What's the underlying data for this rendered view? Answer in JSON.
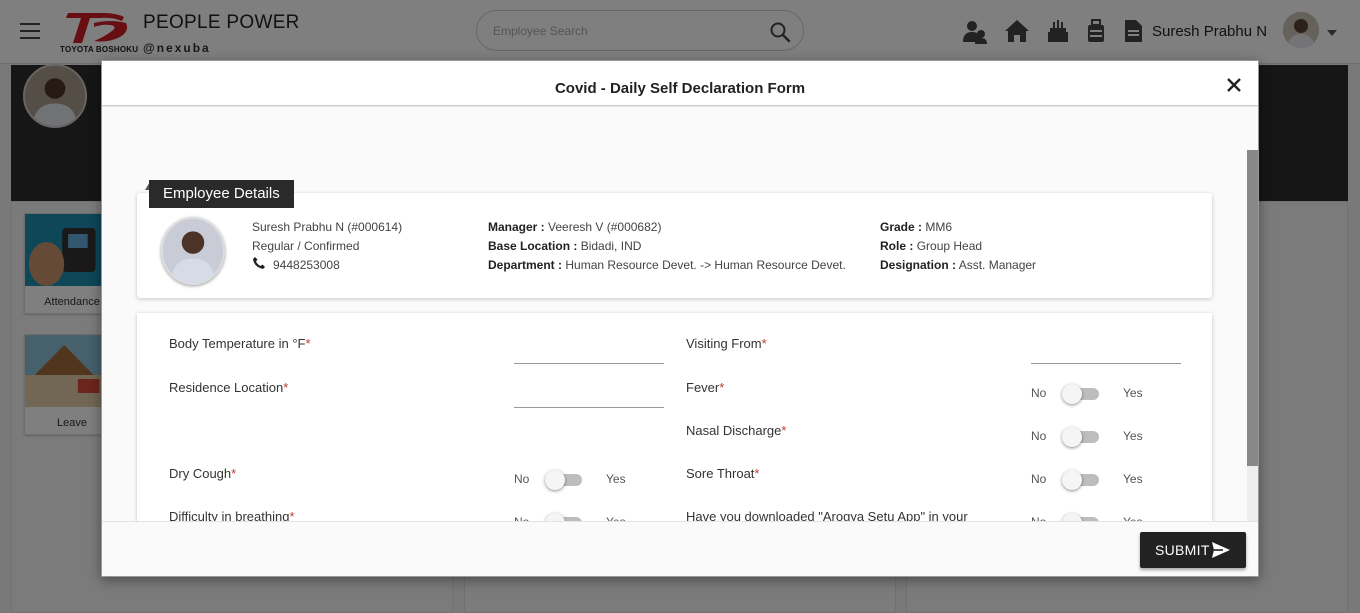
{
  "header": {
    "brand_title": "PEOPLE POWER",
    "brand_handle": "@nexuba",
    "logo_sub": "TOYOTA BOSHOKU",
    "search_placeholder": "Employee Search",
    "user_name": "Suresh Prabhu N"
  },
  "background": {
    "tiles": [
      {
        "label": "Attendance"
      },
      {
        "label": "Leave"
      }
    ]
  },
  "modal": {
    "title": "Covid - Daily Self Declaration Form",
    "section_title": "Employee Details",
    "employee": {
      "name_id": "Suresh Prabhu N (#000614)",
      "status": "Regular / Confirmed",
      "phone": "9448253008",
      "manager_label": "Manager :",
      "manager": "Veeresh V (#000682)",
      "base_location_label": "Base Location :",
      "base_location": "Bidadi, IND",
      "department_label": "Department :",
      "department": "Human Resource Devet. -> Human Resource Devet.",
      "grade_label": "Grade :",
      "grade": "MM6",
      "role_label": "Role :",
      "role": "Group Head",
      "designation_label": "Designation :",
      "designation": "Asst. Manager"
    },
    "fields": {
      "body_temperature": "Body Temperature in °F",
      "visiting_from": "Visiting From",
      "residence_location": "Residence Location",
      "fever": "Fever",
      "nasal_discharge": "Nasal Discharge",
      "dry_cough": "Dry Cough",
      "sore_throat": "Sore Throat",
      "difficulty_breathing": "Difficulty in breathing",
      "arogya_setu": "Have you downloaded \"Arogya Setu App\" in your"
    },
    "toggle_no": "No",
    "toggle_yes": "Yes",
    "required_mark": "*",
    "submit_label": "SUBMIT"
  },
  "colors": {
    "accent_dark": "#222222",
    "brand_red": "#d11f26",
    "required_red": "#c0392b"
  },
  "icons": [
    "menu-icon",
    "search-icon",
    "users-icon",
    "home-icon",
    "cake-icon",
    "luggage-icon",
    "document-icon",
    "chevron-down-icon",
    "close-icon",
    "phone-icon",
    "send-icon",
    "external-link-icon"
  ]
}
